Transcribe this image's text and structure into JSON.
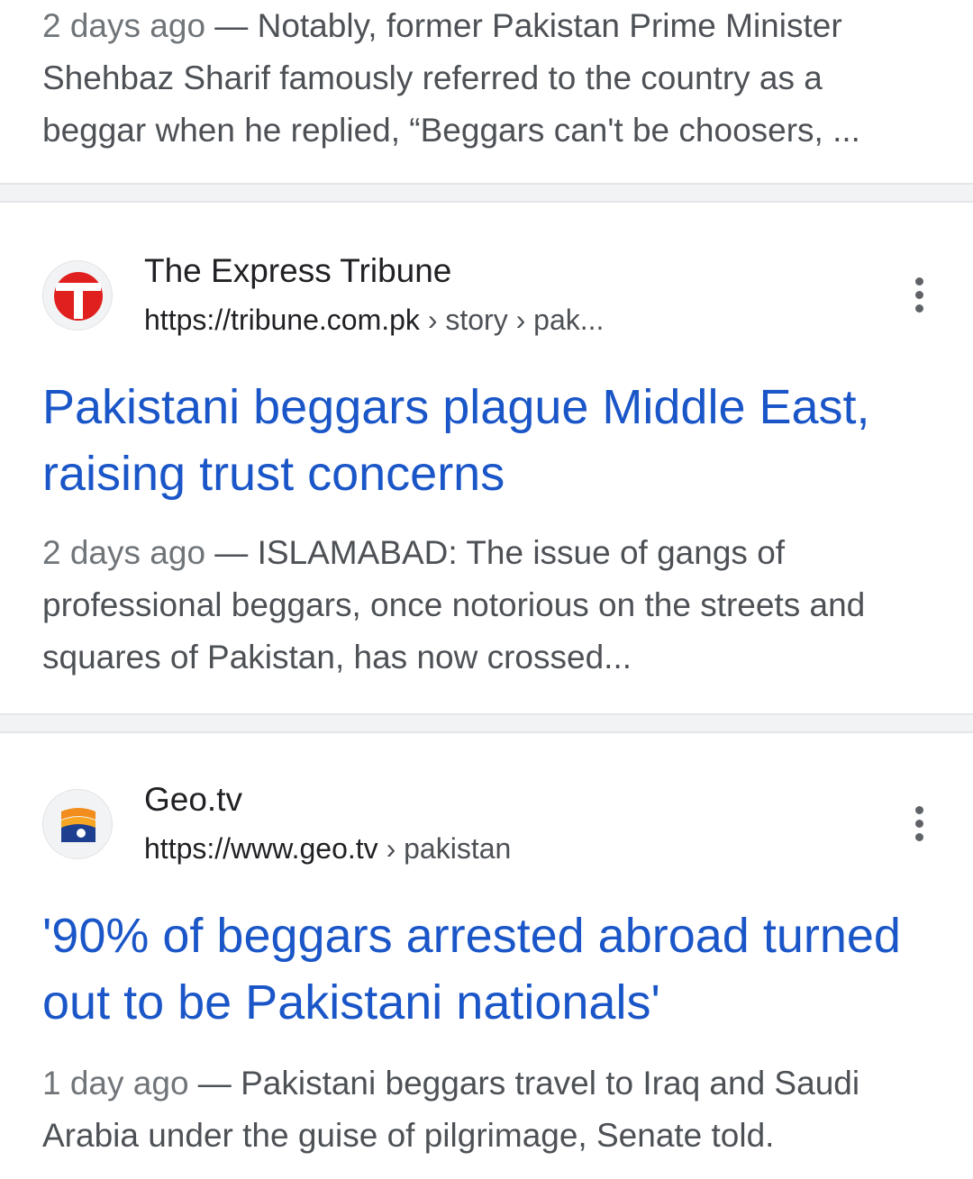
{
  "results": [
    {
      "snippet": {
        "date": "2 days ago",
        "text": "Notably, former Pakistan Prime Minister Shehbaz Sharif famously referred to the country as a beggar when he replied, “Beggars can't be choosers, ..."
      }
    },
    {
      "source": {
        "name": "The Express Tribune",
        "url_base": "https://tribune.com.pk",
        "url_path": "› story › pak...",
        "favicon_icon": "express-tribune-logo-icon",
        "favicon_color": "#e0201f"
      },
      "title": "Pakistani beggars plague Middle East, raising trust concerns",
      "snippet": {
        "date": "2 days ago",
        "text": "ISLAMABAD: The issue of gangs of professional beggars, once notorious on the streets and squares of Pakistan, has now crossed..."
      }
    },
    {
      "source": {
        "name": "Geo.tv",
        "url_base": "https://www.geo.tv",
        "url_path": "› pakistan",
        "favicon_icon": "geo-tv-logo-icon",
        "favicon_color": "#f28c1c"
      },
      "title": "'90% of beggars arrested abroad turned out to be Pakistani nationals'",
      "snippet": {
        "date": "1 day ago",
        "text": "Pakistani beggars travel to Iraq and Saudi Arabia under the guise of pilgrimage, Senate told."
      }
    }
  ],
  "snippet_separator": " — ",
  "menu_icon": "more-vert-icon",
  "colors": {
    "title_link": "#1a56c8",
    "snippet_text": "#4d5156",
    "separator_bg": "#f1f3f4"
  }
}
